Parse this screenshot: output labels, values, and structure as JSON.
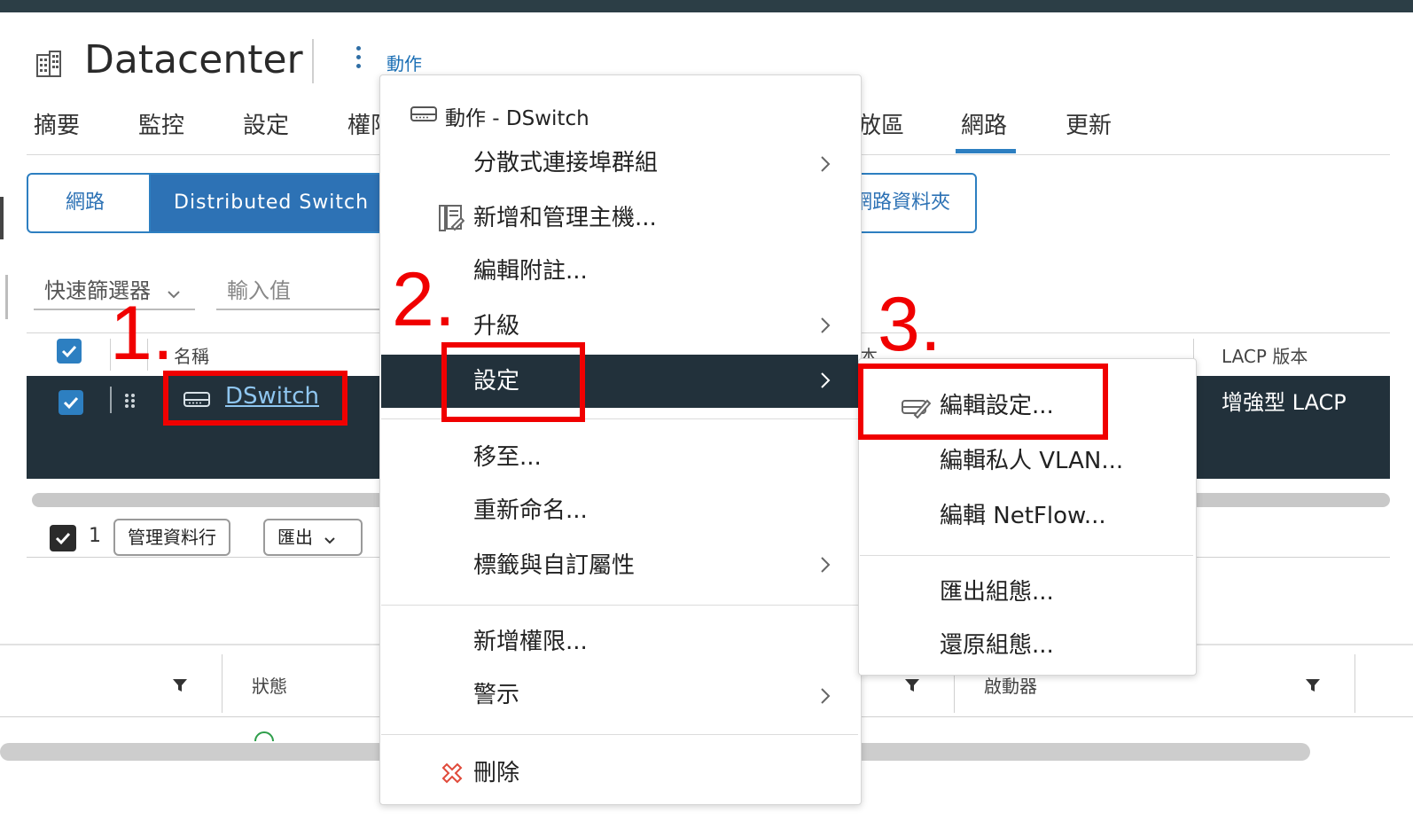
{
  "header": {
    "title": "Datacenter",
    "actions_label": "動作"
  },
  "tabs": [
    {
      "label": "摘要"
    },
    {
      "label": "監控"
    },
    {
      "label": "設定"
    },
    {
      "label": "權限"
    },
    {
      "label": "放區"
    },
    {
      "label": "網路",
      "active": true
    },
    {
      "label": "更新"
    }
  ],
  "subnav": {
    "networks": "網路",
    "distributed_switches": "Distributed Switch",
    "network_folders": "網路資料夾"
  },
  "filter": {
    "quick_filter": "快速篩選器",
    "value_placeholder": "輸入值"
  },
  "grid": {
    "col_name": "名稱",
    "col_version": "本",
    "col_lacp": "LACP 版本",
    "row": {
      "name": "DSwitch",
      "lacp": "增強型 LACP"
    },
    "footer_count": "1",
    "manage_columns": "管理資料行",
    "export": "匯出"
  },
  "bottom_grid": {
    "col_status": "狀態",
    "col_initiator": "啟動器"
  },
  "context_menu": {
    "title": "動作 - DSwitch",
    "items": [
      {
        "label": "分散式連接埠群組",
        "submenu": true
      },
      {
        "label": "新增和管理主機..."
      },
      {
        "label": "編輯附註..."
      },
      {
        "label": "升級",
        "submenu": true
      },
      {
        "label": "設定",
        "submenu": true,
        "selected": true
      },
      {
        "label": "移至..."
      },
      {
        "label": "重新命名..."
      },
      {
        "label": "標籤與自訂屬性",
        "submenu": true
      },
      {
        "label": "新增權限..."
      },
      {
        "label": "警示",
        "submenu": true
      },
      {
        "label": "刪除"
      }
    ]
  },
  "settings_submenu": {
    "items": [
      {
        "label": "編輯設定..."
      },
      {
        "label": "編輯私人 VLAN..."
      },
      {
        "label": "編輯 NetFlow..."
      },
      {
        "label": "匯出組態..."
      },
      {
        "label": "還原組態..."
      }
    ]
  },
  "annotations": {
    "step1": "1.",
    "step2": "2.",
    "step3": "3."
  },
  "colors": {
    "accent": "#2d7fc1",
    "dark_row": "#22313b",
    "annotation_red": "#f00000"
  }
}
